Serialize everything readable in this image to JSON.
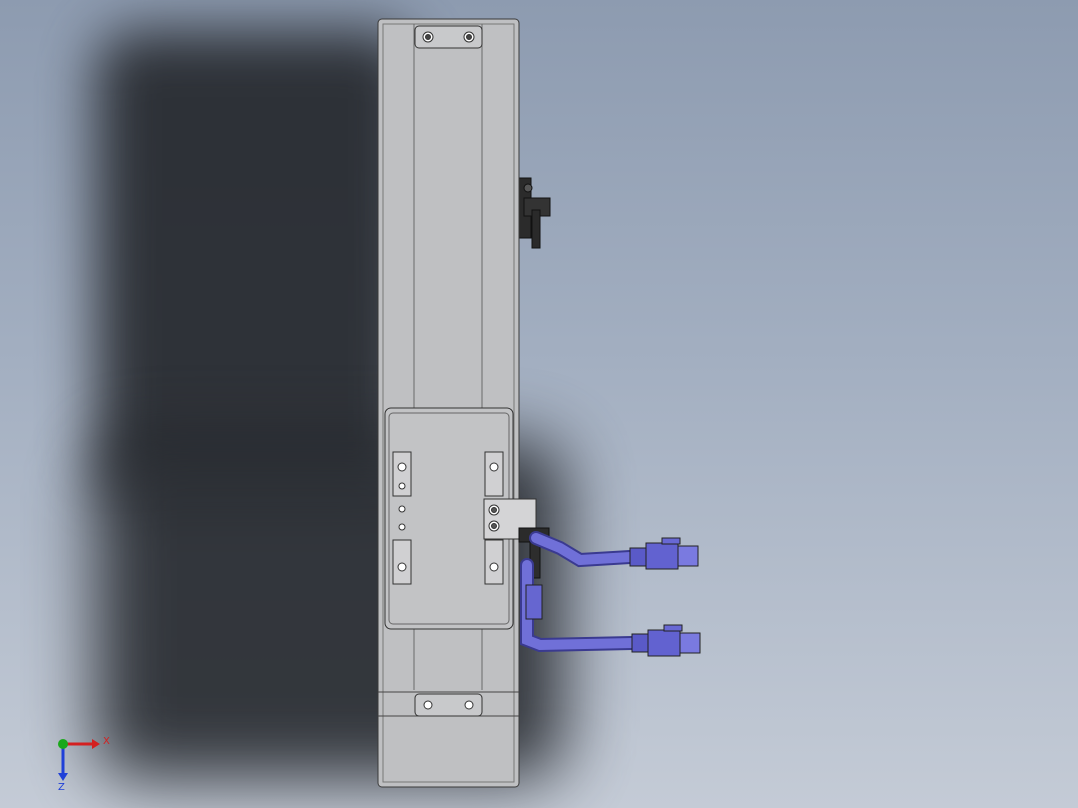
{
  "viewport": {
    "colors": {
      "background_top": "#8d9bb0",
      "background_bottom": "#c4cbd6",
      "body": "#bfc0c2",
      "edge": "#3a3a3a",
      "cable": "#6a6ad0",
      "connector": "#5a5ac8",
      "bracket": "#2b2b2b"
    }
  },
  "triad": {
    "x_label": "X",
    "z_label": "Z",
    "x_color": "#d42020",
    "y_color": "#1aa81a",
    "z_color": "#2040d8"
  }
}
